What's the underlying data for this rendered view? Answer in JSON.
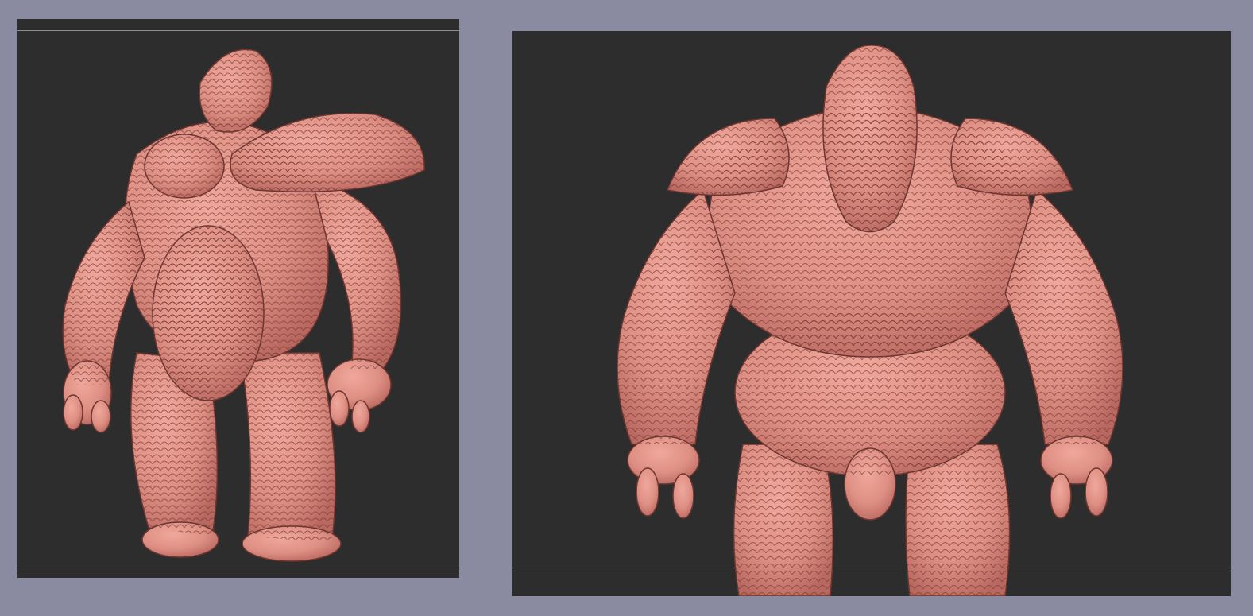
{
  "colors": {
    "app_background": "#8a8ba1",
    "viewport_background": "#2d2d2d",
    "guide_line": "#8e8e8e",
    "model_skin": "#e59589",
    "model_shadow": "#b9685f",
    "model_outline": "#6b3530"
  },
  "views": [
    {
      "name": "three-quarter-view",
      "subject": "sculpted-creature-render"
    },
    {
      "name": "front-view",
      "subject": "sculpted-creature-render"
    }
  ]
}
